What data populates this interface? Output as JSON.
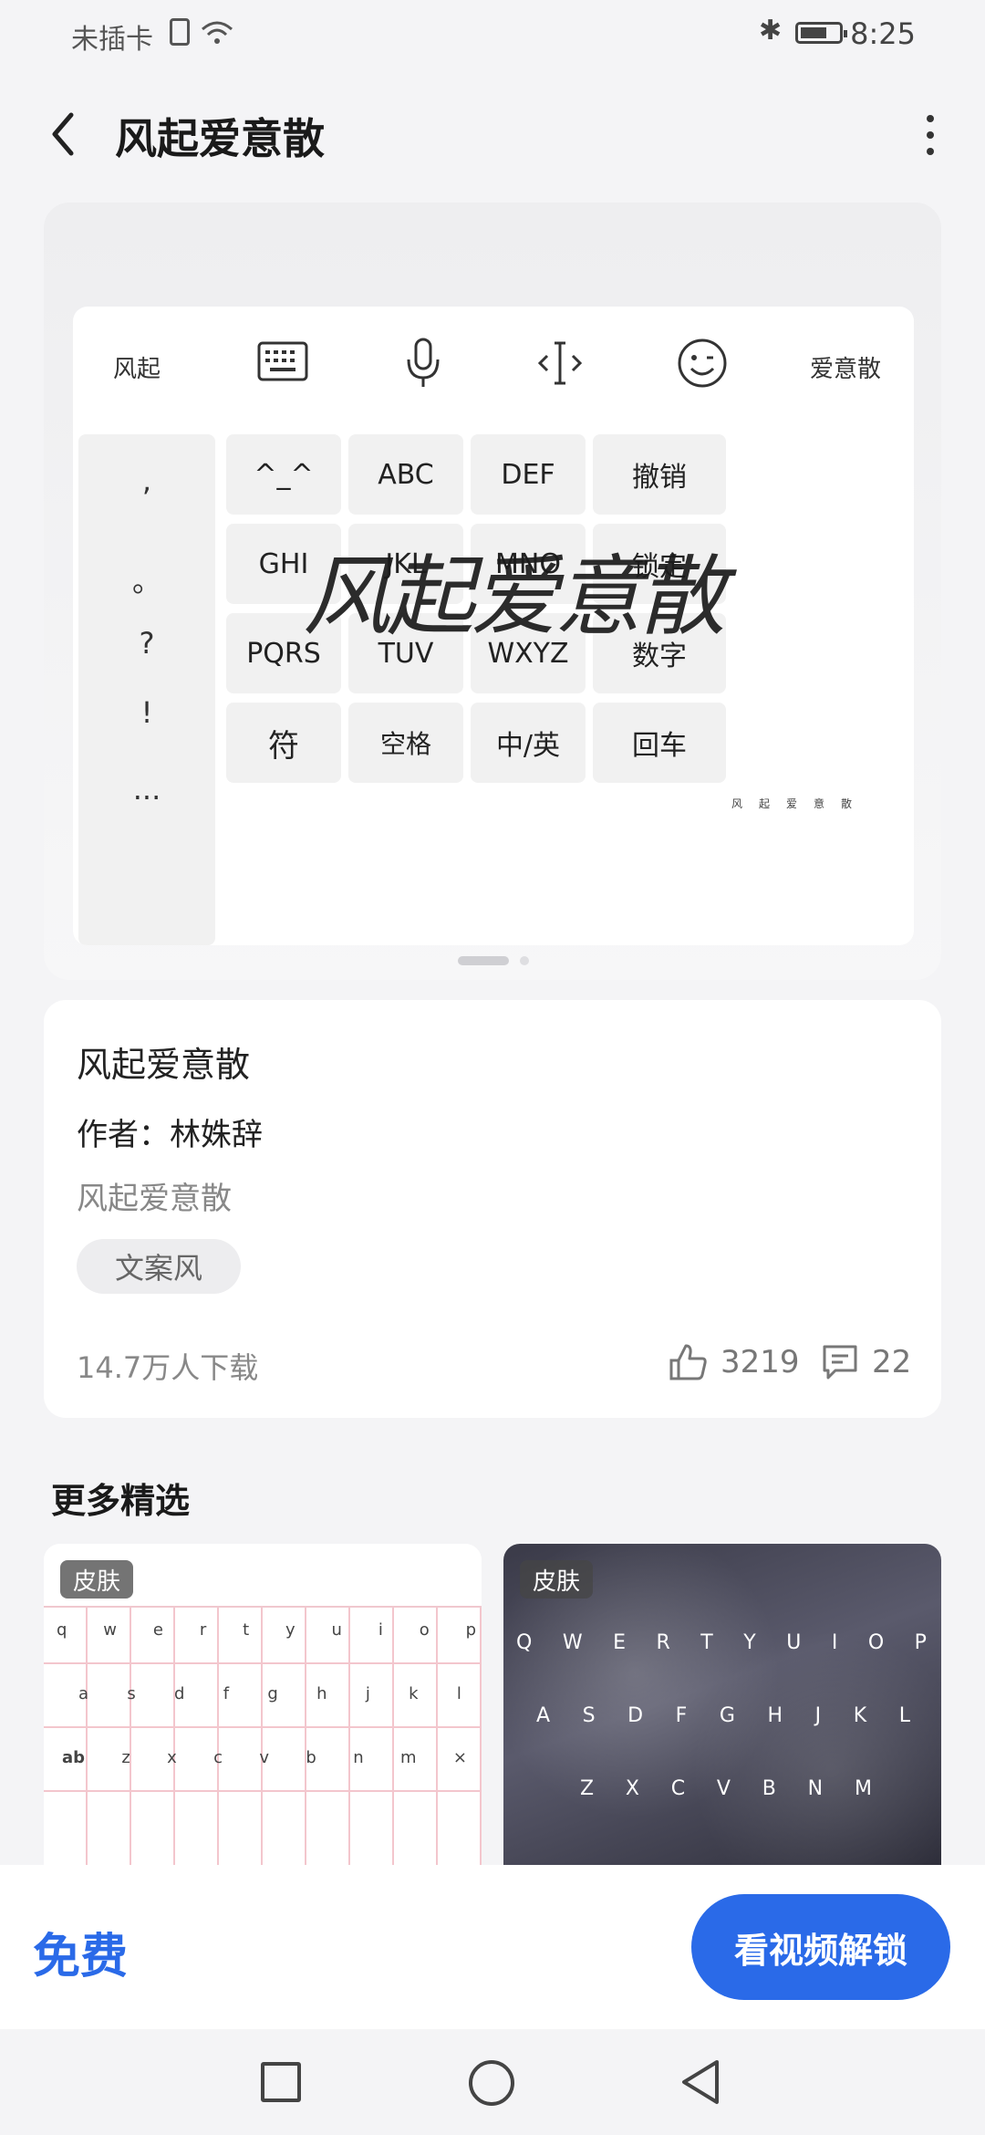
{
  "status_bar": {
    "carrier": "未插卡",
    "time": "8:25"
  },
  "header": {
    "title": "风起爱意散"
  },
  "preview": {
    "toolbar": {
      "left_label": "风起",
      "right_label": "爱意散"
    },
    "punctuation": [
      ",",
      "。",
      "?",
      "!",
      "..."
    ],
    "keys": [
      [
        "^_^",
        "ABC",
        "DEF",
        "撤销"
      ],
      [
        "GHI",
        "JKL",
        "MNO",
        "锁定"
      ],
      [
        "PQRS",
        "TUV",
        "WXYZ",
        "数字"
      ],
      [
        "符",
        "空格",
        "中/英",
        "回车"
      ]
    ],
    "overlay_title": "风起爱意散",
    "overlay_small": "风起爱意散"
  },
  "info": {
    "name": "风起爱意散",
    "author": "作者：林姝辞",
    "description": "风起爱意散",
    "tag": "文案风",
    "downloads": "14.7万人下载",
    "likes": "3219",
    "comments": "22"
  },
  "more": {
    "title": "更多精选",
    "items": [
      {
        "badge": "皮肤",
        "keys_row1": [
          "q",
          "w",
          "e",
          "r",
          "t",
          "y",
          "u",
          "i",
          "o",
          "p"
        ],
        "keys_row2": [
          "a",
          "s",
          "d",
          "f",
          "g",
          "h",
          "j",
          "k",
          "l"
        ],
        "keys_row3": [
          "ab",
          "z",
          "x",
          "c",
          "v",
          "b",
          "n",
          "m",
          "×"
        ]
      },
      {
        "badge": "皮肤",
        "keys_row1": [
          "Q",
          "W",
          "E",
          "R",
          "T",
          "Y",
          "U",
          "I",
          "O",
          "P"
        ],
        "keys_row2": [
          "A",
          "S",
          "D",
          "F",
          "G",
          "H",
          "J",
          "K",
          "L"
        ],
        "keys_row3": [
          "Z",
          "X",
          "C",
          "V",
          "B",
          "N",
          "M"
        ]
      }
    ]
  },
  "action": {
    "free_label": "免费",
    "unlock_label": "看视频解锁"
  },
  "colors": {
    "accent": "#2a6ae8",
    "background": "#f4f4f6",
    "card": "#ffffff"
  }
}
